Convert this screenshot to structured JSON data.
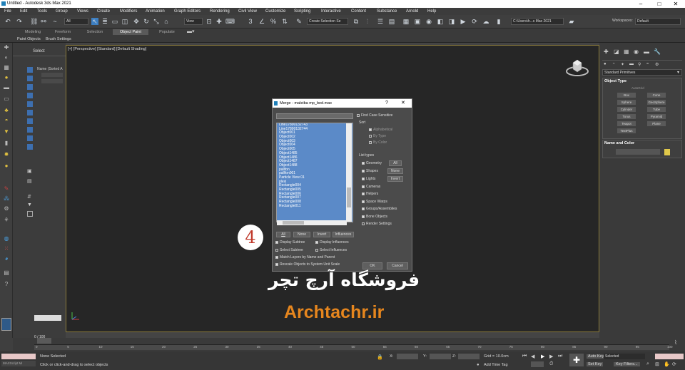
{
  "app": {
    "title": "Untitled - Autodesk 3ds Max 2021"
  },
  "menu": [
    "File",
    "Edit",
    "Tools",
    "Group",
    "Views",
    "Create",
    "Modifiers",
    "Animation",
    "Graph Editors",
    "Rendering",
    "Civil View",
    "Customize",
    "Scripting",
    "Interactive",
    "Content",
    "Substance",
    "Arnold",
    "Help"
  ],
  "toolbar": {
    "filter": "All",
    "ref_coord": "View",
    "selection_set": "Create Selection Se",
    "project_path": "C:\\Users\\h...s Max 2021",
    "workspaces_label": "Workspaces:",
    "workspace": "Default"
  },
  "ribbon": {
    "tabs": [
      "Modeling",
      "Freeform",
      "Selection",
      "Object Paint",
      "Populate"
    ],
    "active_tab": "Object Paint",
    "subtabs": [
      "Paint Objects",
      "Brush Settings"
    ]
  },
  "scene_explorer": {
    "select_tab": "Select",
    "column": "Name (Sorted A"
  },
  "viewport": {
    "label": "[+] [Perspective] [Standard] [Default Shading]"
  },
  "command_panel": {
    "category": "Standard Primitives",
    "rollout_object_type": "Object Type",
    "autogrid": "AutoGrid",
    "primitives": [
      "Box",
      "Cone",
      "Sphere",
      "GeoSphere",
      "Cylinder",
      "Tube",
      "Torus",
      "Pyramid",
      "Teapot",
      "Plane",
      "TextPlus"
    ],
    "rollout_name_color": "Name and Color"
  },
  "dialog": {
    "title": "Merge - maleiba mp_bed.max",
    "help": "?",
    "close": "✕",
    "items": [
      "Line17890132743",
      "Line17890132744",
      "Object001",
      "Object002",
      "Object003",
      "Object004",
      "Object005",
      "Object1485",
      "Object1486",
      "Object1487",
      "Object1488",
      "pallfon",
      "pallfon001",
      "Particle View 01",
      "plexi",
      "Rectangle004",
      "Rectangle005",
      "Rectangle006",
      "Rectangle007",
      "Rectangle008",
      "Rectangle011"
    ],
    "find_case_sensitive": "Find Case Sensitive",
    "sort_label": "Sort",
    "sort_options": [
      "Alphabetical",
      "By Type",
      "By Color"
    ],
    "list_types_label": "List types",
    "list_types": [
      "Geometry",
      "Shapes",
      "Lights",
      "Cameras",
      "Helpers",
      "Space Warps",
      "Groups/Assemblies",
      "Bone Objects",
      "Render Settings"
    ],
    "type_buttons": {
      "all": "All",
      "none": "None",
      "invert": "Invert"
    },
    "bottom_buttons": {
      "all": "All",
      "none": "None",
      "invert": "Invert",
      "influences": "Influences"
    },
    "options": {
      "display_subtree": "Display Subtree",
      "display_influences": "Display Influences",
      "select_subtree": "Select Subtree",
      "select_influences": "Select Influences",
      "match_layers": "Match Layers by Name and Parent",
      "rescale": "Rescale Objects to System Unit Scale"
    },
    "ok": "OK",
    "cancel": "Cancel"
  },
  "timeline": {
    "frame": "0 / 100",
    "ticks": [
      "0",
      "5",
      "10",
      "15",
      "20",
      "25",
      "30",
      "35",
      "40",
      "45",
      "50",
      "55",
      "60",
      "65",
      "70",
      "75",
      "80",
      "85",
      "90",
      "95",
      "100"
    ]
  },
  "status": {
    "maxscript": "MAXScript Mi",
    "selection": "None Selected",
    "prompt": "Click or click-and-drag to select objects",
    "x_label": "X:",
    "y_label": "Y:",
    "z_label": "Z:",
    "grid": "Grid = 10.0cm",
    "add_time_tag": "Add Time Tag",
    "auto_key": "Auto Key",
    "set_key": "Set Key",
    "selected": "Selected",
    "key_filters": "Key Filters..."
  },
  "overlay": {
    "step": "4",
    "watermark_fa": "فروشگاه آرچ تچر",
    "watermark_en": "Archtachr.ir"
  }
}
